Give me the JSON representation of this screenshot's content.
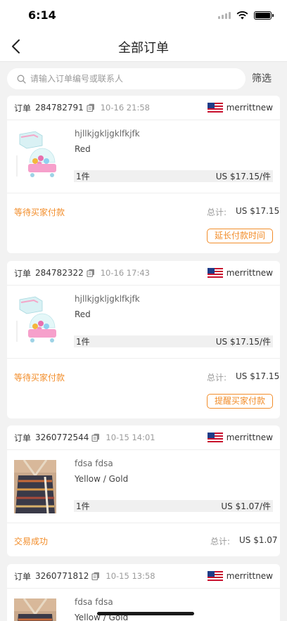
{
  "status_bar": {
    "time": "6:14"
  },
  "nav": {
    "title": "全部订单"
  },
  "search": {
    "placeholder": "请输入订单编号或联系人",
    "filter_label": "筛选"
  },
  "labels": {
    "order_prefix": "订单",
    "total_prefix": "总计:"
  },
  "colors": {
    "accent": "#f28d2a",
    "background": "#f2f2f2"
  },
  "orders": [
    {
      "order_no": "284782791",
      "time": "10-16 21:58",
      "store": "merrittnew",
      "product_title": "hjllkjgkljgklfkjfk",
      "variant": "Red",
      "qty": "1件",
      "unit_price": "US $17.15/件",
      "status": "等待买家付款",
      "total": "US $17.15",
      "action": "延长付款时间",
      "image": "toy-playset"
    },
    {
      "order_no": "284782322",
      "time": "10-16 17:43",
      "store": "merrittnew",
      "product_title": "hjllkjgkljgklfkjfk",
      "variant": "Red",
      "qty": "1件",
      "unit_price": "US $17.15/件",
      "status": "等待买家付款",
      "total": "US $17.15",
      "action": "提醒买家付款",
      "image": "toy-playset"
    },
    {
      "order_no": "3260772544",
      "time": "10-15 14:01",
      "store": "merrittnew",
      "product_title": "fdsa fdsa",
      "variant": "Yellow / Gold",
      "qty": "1件",
      "unit_price": "US $1.07/件",
      "status": "交易成功",
      "total": "US $1.07",
      "image": "halter-top"
    },
    {
      "order_no": "3260771812",
      "time": "10-15 13:58",
      "store": "merrittnew",
      "product_title": "fdsa fdsa",
      "variant": "Yellow / Gold",
      "image": "halter-top"
    }
  ]
}
